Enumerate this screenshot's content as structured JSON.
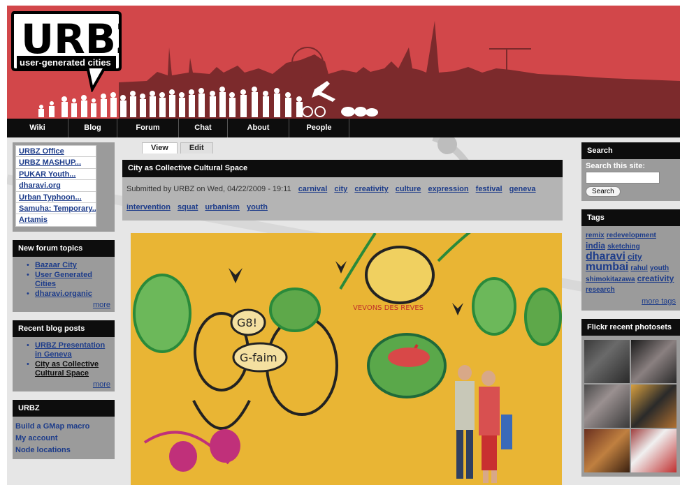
{
  "header": {
    "logo_main": "URBZ",
    "logo_tagline": "user-generated cities"
  },
  "nav": {
    "items": [
      {
        "label": "Wiki"
      },
      {
        "label": "Blog"
      },
      {
        "label": "Forum"
      },
      {
        "label": "Chat"
      },
      {
        "label": "About"
      },
      {
        "label": "People"
      }
    ]
  },
  "left_sidebar": {
    "links": [
      "URBZ Office",
      "URBZ MASHUP...",
      "PUKAR Youth...",
      "dharavi.org",
      "Urban Typhoon...",
      "Samuha: Temporary...",
      "Artamis"
    ],
    "forum": {
      "title": "New forum topics",
      "items": [
        "Bazaar City",
        "User Generated Cities",
        "dharavi.organic"
      ],
      "more": "more"
    },
    "blog": {
      "title": "Recent blog posts",
      "items": [
        "URBZ Presentation in Geneva",
        "City as Collective Cultural Space"
      ],
      "more": "more"
    },
    "menu": {
      "title": "URBZ",
      "items": [
        "Build a GMap macro",
        "My account",
        "Node locations"
      ]
    }
  },
  "content": {
    "tabs": [
      {
        "label": "View",
        "active": true
      },
      {
        "label": "Edit",
        "active": false
      }
    ],
    "title": "City as Collective Cultural Space",
    "submitted": "Submitted by URBZ on Wed, 04/22/2009 - 19:11",
    "terms": [
      "carnival",
      "city",
      "creativity",
      "culture",
      "expression",
      "festival",
      "geneva",
      "intervention",
      "squat",
      "urbanism",
      "youth"
    ],
    "mural_text": {
      "g8": "G8!",
      "gfaim": "G-faim",
      "graffiti": "VEVONS DES REVES"
    }
  },
  "right_sidebar": {
    "search": {
      "title": "Search",
      "label": "Search this site:",
      "value": "",
      "button": "Search"
    },
    "tags": {
      "title": "Tags",
      "items": [
        {
          "text": "remix",
          "size": 10
        },
        {
          "text": "redevelopment",
          "size": 10
        },
        {
          "text": "india",
          "size": 12
        },
        {
          "text": "sketching",
          "size": 10
        },
        {
          "text": "dharavi",
          "size": 16
        },
        {
          "text": "city",
          "size": 12
        },
        {
          "text": "mumbai",
          "size": 16
        },
        {
          "text": "rahul",
          "size": 10
        },
        {
          "text": "youth",
          "size": 10
        },
        {
          "text": "shimokitazawa",
          "size": 10
        },
        {
          "text": "creativity",
          "size": 12
        },
        {
          "text": "research",
          "size": 10
        }
      ],
      "more": "more tags"
    },
    "flickr": {
      "title": "Flickr recent photosets"
    }
  },
  "colors": {
    "header_red": "#d2474a",
    "nav_black": "#0d0d0d",
    "link_blue": "#1d3c8a",
    "sidebar_gray": "#9b9b9b",
    "mural_yellow": "#e9b534"
  }
}
